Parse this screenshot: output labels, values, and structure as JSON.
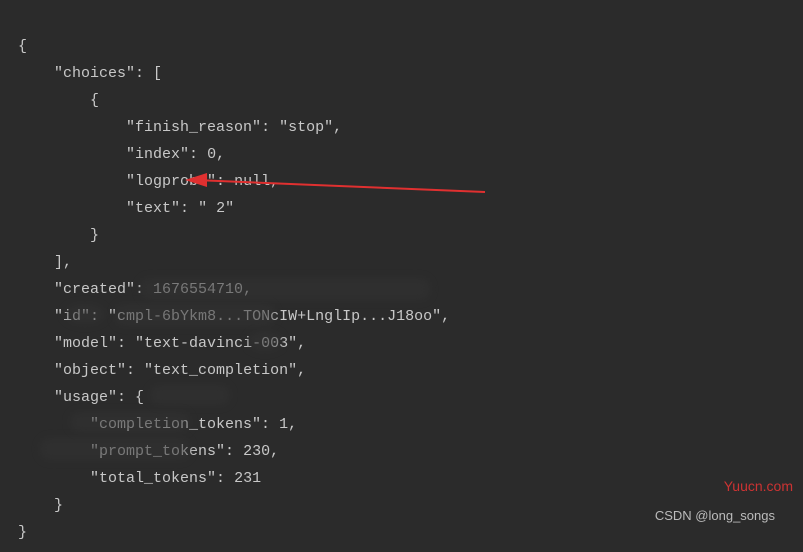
{
  "json_response": {
    "open_brace": "{",
    "choices_key": "\"choices\"",
    "choices_open": ": [",
    "item_open": "{",
    "finish_reason_key": "\"finish_reason\"",
    "finish_reason_val": "\"stop\"",
    "index_key": "\"index\"",
    "index_val": "0",
    "logprobs_key": "\"logprobs\"",
    "logprobs_val": "null",
    "text_key": "\"text\"",
    "text_val": "\" 2\"",
    "item_close": "}",
    "choices_close": "],",
    "created_key": "\"created\"",
    "created_val": "1676554710",
    "id_key": "\"id\"",
    "id_val": "\"cmpl-6bYkm8...TONcIW+LnglIp...J18oo\"",
    "model_key": "\"model\"",
    "model_val": "\"text-davinci-003\"",
    "object_key": "\"object\"",
    "object_val": "\"text_completion\"",
    "usage_key": "\"usage\"",
    "usage_open": ": {",
    "completion_tokens_key": "\"completion_tokens\"",
    "completion_tokens_val": "1",
    "prompt_tokens_key": "\"prompt_tokens\"",
    "prompt_tokens_val": "230",
    "total_tokens_key": "\"total_tokens\"",
    "total_tokens_val": "231",
    "usage_close": "}",
    "close_brace": "}",
    "comma": ",",
    "colon_sp": ": "
  },
  "watermarks": {
    "top": "Yuucn.com",
    "bottom": "CSDN @long_songs"
  }
}
